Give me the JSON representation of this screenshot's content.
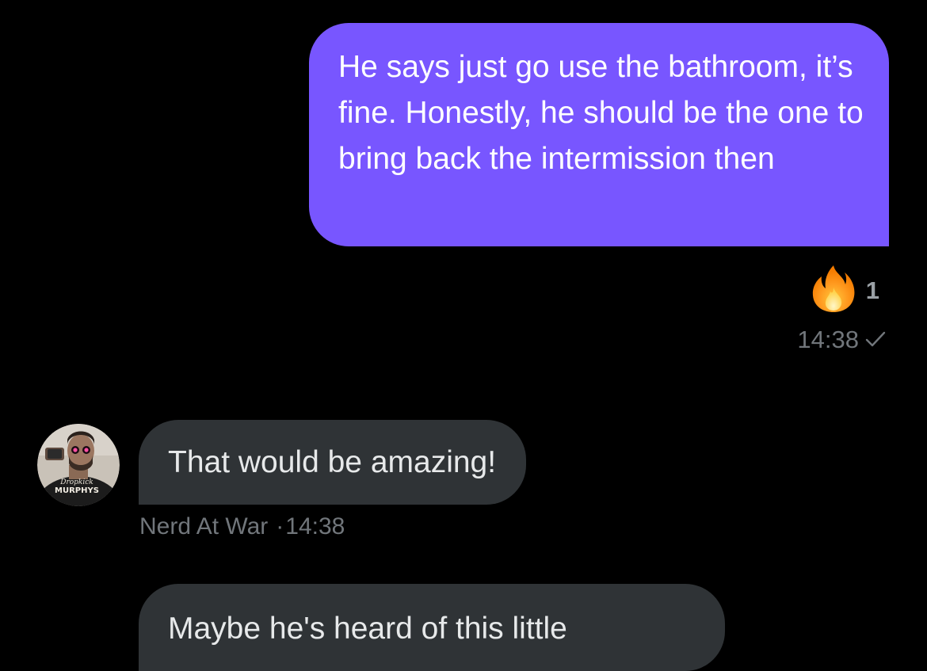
{
  "colors": {
    "background": "#000000",
    "outgoing_bubble": "#7856ff",
    "incoming_bubble": "#2f3336",
    "meta_text": "#71767b"
  },
  "conversation": {
    "messages": [
      {
        "direction": "outgoing",
        "text": "He says just go use the bathroom, it’s fine. Honestly, he should be the one to bring back the intermission then",
        "reaction": {
          "icon": "fire-emoji-icon",
          "count": "1"
        },
        "time": "14:38",
        "status_icon": "checkmark-icon"
      },
      {
        "direction": "incoming",
        "avatar_icon": "avatar-image",
        "avatar_text": [
          "Dropkick",
          "MURPHYS"
        ],
        "text": "That would be amazing!",
        "sender": "Nerd At War",
        "separator": "·",
        "time": "14:38"
      },
      {
        "direction": "incoming",
        "text": "Maybe he's heard of this little"
      }
    ]
  }
}
